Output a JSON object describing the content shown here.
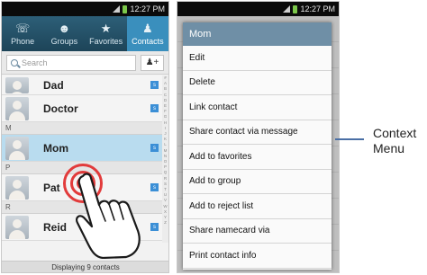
{
  "left": {
    "status_time": "12:27 PM",
    "tabs": [
      {
        "label": "Phone",
        "icon": "phone-icon"
      },
      {
        "label": "Groups",
        "icon": "groups-icon"
      },
      {
        "label": "Favorites",
        "icon": "star-icon"
      },
      {
        "label": "Contacts",
        "icon": "person-icon"
      }
    ],
    "active_tab": "Contacts",
    "search_placeholder": "Search",
    "contacts": {
      "dad": "Dad",
      "doctor": "Doctor",
      "section_m": "M",
      "mom": "Mom",
      "section_p": "P",
      "pat": "Pat",
      "section_r": "R",
      "reid": "Reid"
    },
    "index_letters": [
      "#",
      "A",
      "B",
      "C",
      "D",
      "E",
      "F",
      "G",
      "H",
      "I",
      "J",
      "K",
      "L",
      "M",
      "N",
      "O",
      "P",
      "Q",
      "R",
      "S",
      "T",
      "U",
      "V",
      "W",
      "X",
      "Y",
      "Z"
    ],
    "footer": "Displaying 9 contacts"
  },
  "right": {
    "status_time": "12:27 PM",
    "menu_title": "Mom",
    "items": [
      "Edit",
      "Delete",
      "Link contact",
      "Share contact via message",
      "Add to favorites",
      "Add to group",
      "Add to reject list",
      "Share namecard via",
      "Print contact info"
    ]
  },
  "callout": {
    "line1": "Context",
    "line2": "Menu"
  },
  "colors": {
    "tab_bar": "#1d4458",
    "active_tab": "#3a8fbd",
    "selected_row": "#b9dcef",
    "menu_header": "#6f8fa6",
    "ripple": "#e23b3b",
    "callout_line": "#4a6fa5"
  }
}
